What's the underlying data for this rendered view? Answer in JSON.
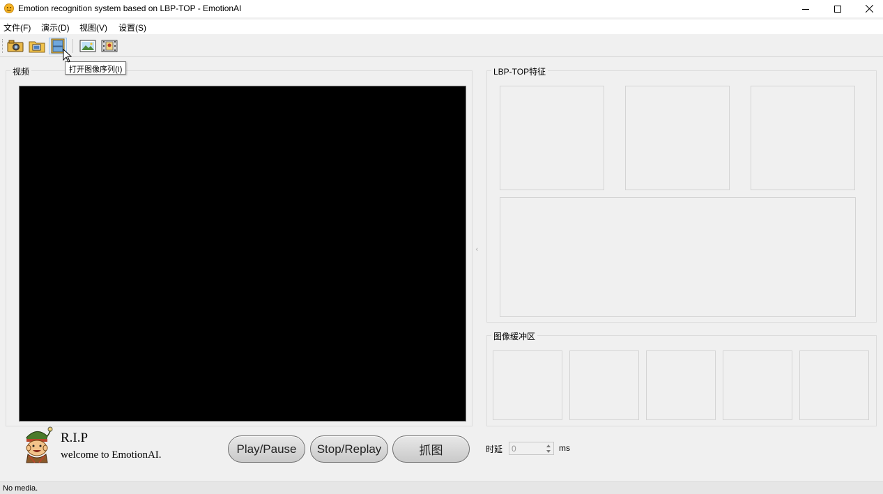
{
  "window": {
    "title": "Emotion recognition system based on LBP-TOP - EmotionAI"
  },
  "menu": [
    {
      "label": "文件(F)"
    },
    {
      "label": "演示(D)"
    },
    {
      "label": "视图(V)"
    },
    {
      "label": "设置(S)"
    }
  ],
  "toolbar": {
    "buttons": [
      {
        "icon": "camera-icon"
      },
      {
        "icon": "open-video-icon"
      },
      {
        "icon": "image-sequence-icon",
        "active": true
      },
      {
        "icon": "picture-icon"
      },
      {
        "icon": "film-icon"
      }
    ],
    "tooltip": "打开图像序列(I)"
  },
  "video_panel": {
    "title": "视频"
  },
  "features_panel": {
    "title": "LBP-TOP特征"
  },
  "buffer_panel": {
    "title": "图像缓冲区"
  },
  "branding": {
    "title": "R.I.P",
    "subtitle": "welcome to EmotionAI."
  },
  "controls": {
    "play_pause": "Play/Pause",
    "stop_replay": "Stop/Replay",
    "capture": "抓图",
    "delay_label": "时延",
    "delay_value": "0",
    "delay_unit": "ms"
  },
  "status": {
    "text": "No media."
  },
  "colors": {
    "video_bg": "#000000",
    "window_bg": "#f0f0f0"
  }
}
